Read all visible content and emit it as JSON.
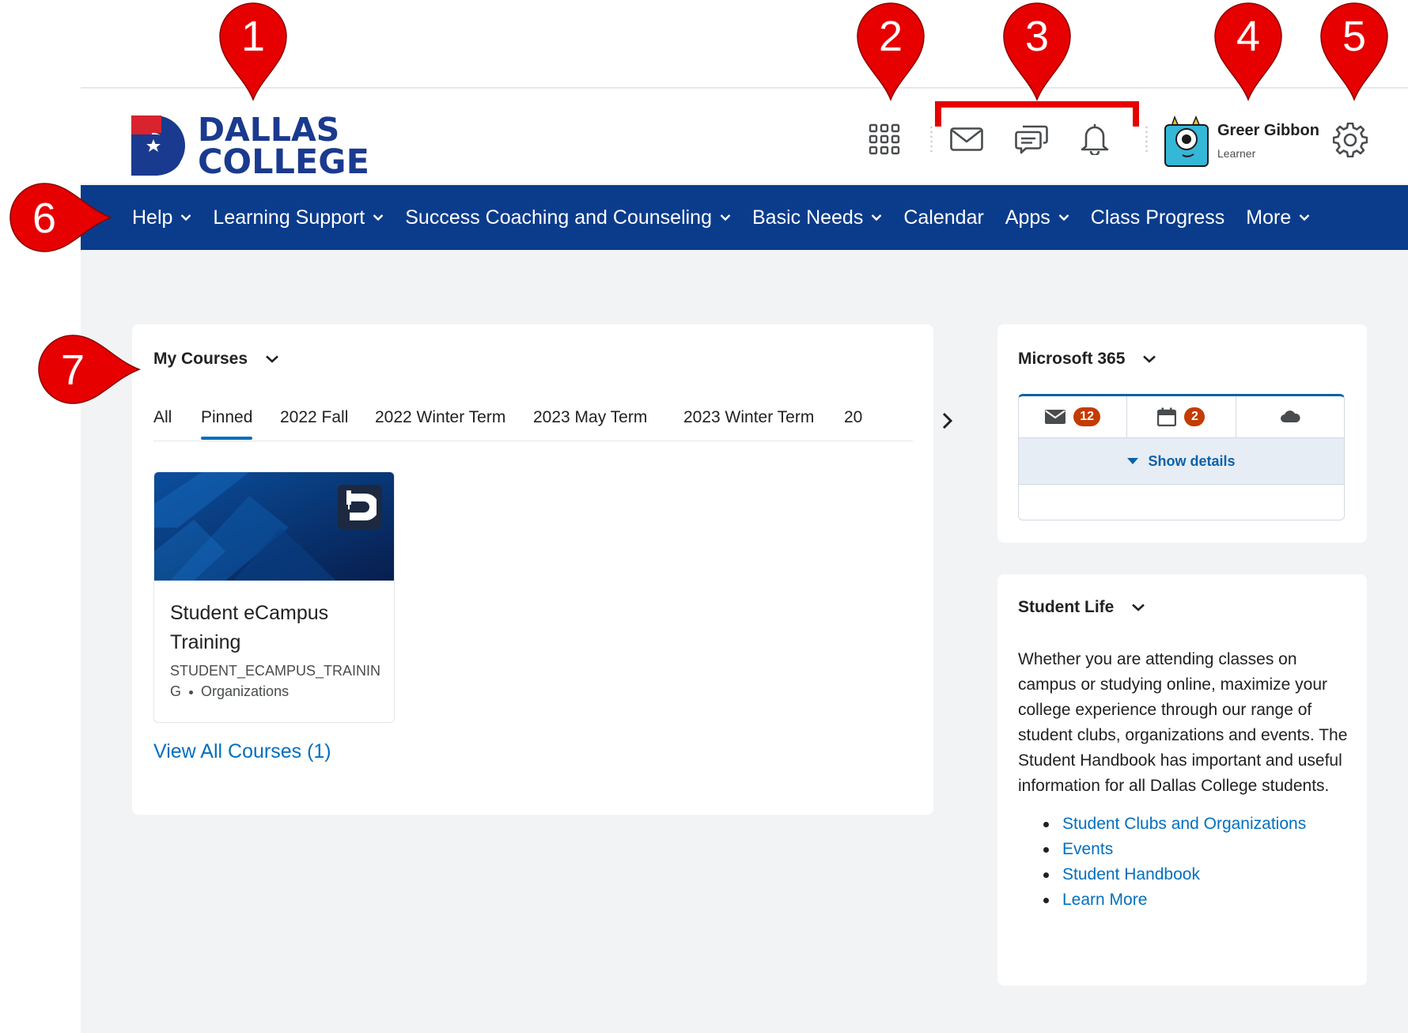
{
  "header": {
    "logo": {
      "line1": "DALLAS",
      "line2": "COLLEGE"
    },
    "icons": [
      "grid-icon",
      "mail-icon",
      "chat-icon",
      "bell-icon",
      "gear-icon"
    ],
    "user": {
      "name": "Greer Gibbon",
      "role": "Learner"
    }
  },
  "nav": {
    "items": [
      {
        "label": "Help",
        "dropdown": true
      },
      {
        "label": "Learning Support",
        "dropdown": true
      },
      {
        "label": "Success Coaching and Counseling",
        "dropdown": true
      },
      {
        "label": "Basic Needs",
        "dropdown": true
      },
      {
        "label": "Calendar",
        "dropdown": false
      },
      {
        "label": "Apps",
        "dropdown": true
      },
      {
        "label": "Class Progress",
        "dropdown": false
      },
      {
        "label": "More",
        "dropdown": true
      }
    ]
  },
  "my_courses": {
    "title": "My Courses",
    "tabs": [
      "All",
      "Pinned",
      "2022 Fall",
      "2022 Winter Term",
      "2023 May Term",
      "2023 Winter Term",
      "20"
    ],
    "active_tab": "Pinned",
    "course": {
      "name": "Student eCampus Training",
      "code": "STUDENT_ECAMPUS_TRAINING",
      "type": "Organizations"
    },
    "view_all": "View All Courses (1)"
  },
  "microsoft_365": {
    "title": "Microsoft 365",
    "mail_count": "12",
    "calendar_count": "2",
    "show_details": "Show details"
  },
  "student_life": {
    "title": "Student Life",
    "text": "Whether you are attending classes on campus or studying online, maximize your college experience through our range of student clubs, organizations and events. The Student Handbook has important and useful information for all Dallas College students.",
    "links": [
      "Student Clubs and Organizations",
      "Events",
      "Student Handbook",
      "Learn More"
    ]
  },
  "callouts": [
    "1",
    "2",
    "3",
    "4",
    "5",
    "6",
    "7"
  ],
  "colors": {
    "brand_blue": "#0b3c8c",
    "brand_red": "#d9232e",
    "link_blue": "#006fbf",
    "badge_orange": "#c33c00",
    "callout_red": "#e60000"
  }
}
